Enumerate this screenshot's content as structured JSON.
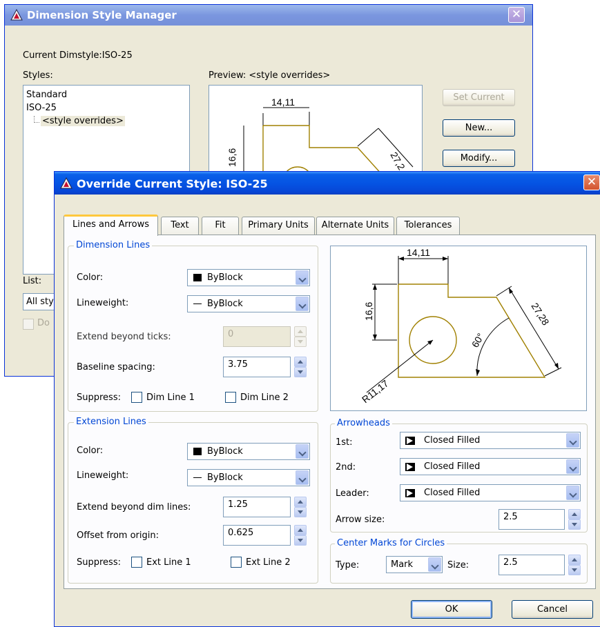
{
  "back_window": {
    "title": "Dimension Style Manager",
    "current_dimstyle": "Current Dimstyle:ISO-25",
    "styles_label": "Styles:",
    "styles": [
      "Standard",
      "ISO-25",
      "<style overrides>"
    ],
    "preview_label": "Preview: <style overrides>",
    "buttons": {
      "set_current": "Set Current",
      "new": "New...",
      "modify": "Modify..."
    },
    "list_label": "List:",
    "list_value": "All sty",
    "dont_label": "Do"
  },
  "dialog": {
    "title": "Override Current Style: ISO-25",
    "tabs": [
      "Lines and Arrows",
      "Text",
      "Fit",
      "Primary Units",
      "Alternate Units",
      "Tolerances"
    ],
    "dimension_lines": {
      "title": "Dimension Lines",
      "color_label": "Color:",
      "color_value": "ByBlock",
      "lineweight_label": "Lineweight:",
      "lineweight_value": "ByBlock",
      "extend_ticks_label": "Extend beyond ticks:",
      "extend_ticks_value": "0",
      "baseline_label": "Baseline spacing:",
      "baseline_value": "3.75",
      "suppress_label": "Suppress:",
      "dim_line1": "Dim Line 1",
      "dim_line2": "Dim Line 2"
    },
    "extension_lines": {
      "title": "Extension Lines",
      "color_label": "Color:",
      "color_value": "ByBlock",
      "lineweight_label": "Lineweight:",
      "lineweight_value": "ByBlock",
      "extend_dim_label": "Extend beyond dim lines:",
      "extend_dim_value": "1.25",
      "offset_label": "Offset from origin:",
      "offset_value": "0.625",
      "suppress_label": "Suppress:",
      "ext_line1": "Ext Line 1",
      "ext_line2": "Ext Line 2"
    },
    "arrowheads": {
      "title": "Arrowheads",
      "first_label": "1st:",
      "first_value": "Closed Filled",
      "second_label": "2nd:",
      "second_value": "Closed Filled",
      "leader_label": "Leader:",
      "leader_value": "Closed Filled",
      "size_label": "Arrow size:",
      "size_value": "2.5"
    },
    "center_marks": {
      "title": "Center Marks for Circles",
      "type_label": "Type:",
      "type_value": "Mark",
      "size_label": "Size:",
      "size_value": "2.5"
    },
    "preview": {
      "dim_top": "14,11",
      "dim_left": "16,6",
      "dim_diag": "27,28",
      "dim_angle": "60°",
      "dim_radius": "R11,17"
    },
    "buttons": {
      "ok": "OK",
      "cancel": "Cancel"
    }
  },
  "colors": {
    "title_active": "#0554e3",
    "group_title": "#0046d5",
    "drawing_line": "#a08000",
    "dim_line": "#000000"
  }
}
